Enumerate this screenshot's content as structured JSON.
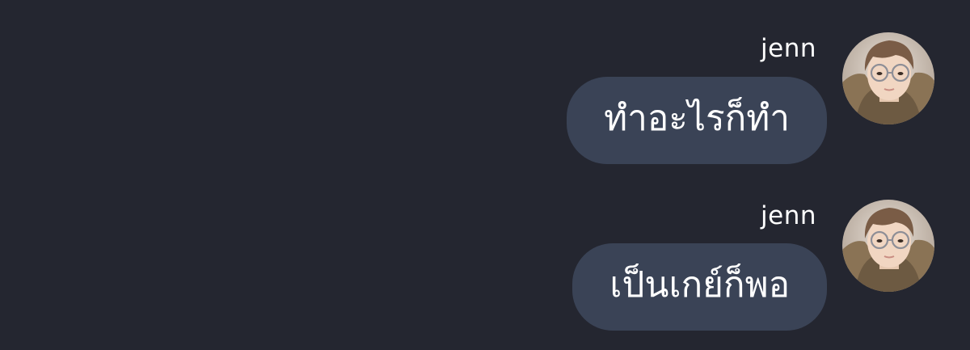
{
  "conversation": {
    "messages": [
      {
        "sender": "jenn",
        "text": "ทำอะไรก็ทำ",
        "avatar_icon": "user-photo-avatar"
      },
      {
        "sender": "jenn",
        "text": "เป็นเกย์ก็พอ",
        "avatar_icon": "user-photo-avatar"
      }
    ]
  },
  "colors": {
    "background": "#242630",
    "bubble": "#3a4356",
    "text": "#ffffff"
  }
}
